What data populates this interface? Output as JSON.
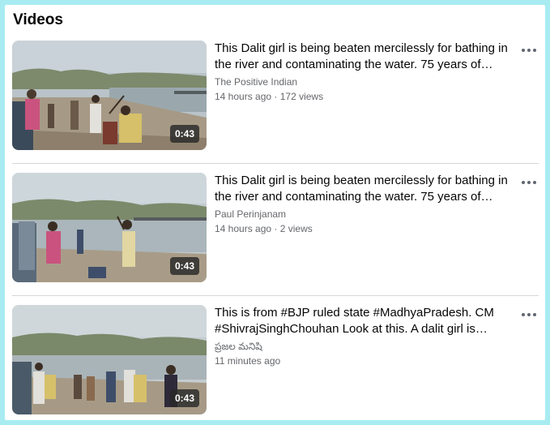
{
  "section": {
    "title": "Videos"
  },
  "videos": [
    {
      "title": "This Dalit girl is being beaten mercilessly for bathing in the river and contaminating the water. 75 years of…",
      "author": "The Positive Indian",
      "meta": "14 hours ago · 172 views",
      "duration": "0:43"
    },
    {
      "title": "This Dalit girl is being beaten mercilessly for bathing in the river and contaminating the water. 75 years of…",
      "author": "Paul Perinjanam",
      "meta": "14 hours ago · 2 views",
      "duration": "0:43"
    },
    {
      "title": "This is from #BJP ruled state #MadhyaPradesh. CM #ShivrajSinghChouhan Look at this. A dalit girl is…",
      "author": "ప్రజల మనిషి",
      "meta": "11 minutes ago",
      "duration": "0:43"
    }
  ],
  "icons": {
    "more": "more-horizontal-icon"
  }
}
